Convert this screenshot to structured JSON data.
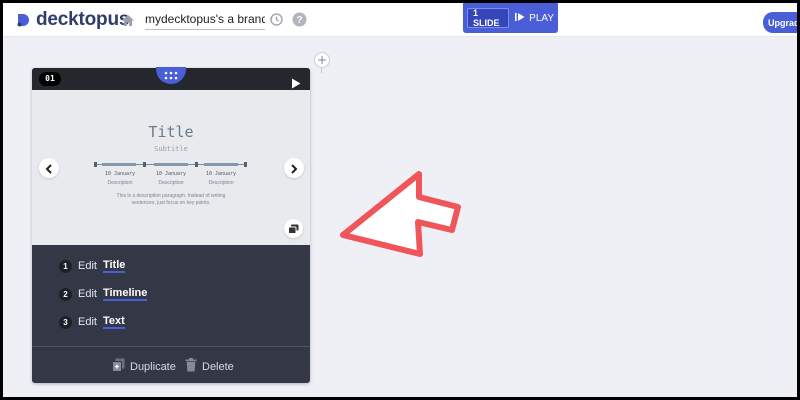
{
  "header": {
    "logo_text": "decktopus",
    "deck_name": "mydecktopus's a brand new",
    "slides_label": "1 SLIDE",
    "play_label": "PLAY",
    "upgrade_label": "Upgrade"
  },
  "add_slide": {
    "symbol": "+"
  },
  "slide": {
    "number": "01",
    "preview": {
      "title": "Title",
      "subtitle": "Subtitle",
      "timeline": [
        {
          "date": "10 January",
          "desc": "Description"
        },
        {
          "date": "10 January",
          "desc": "Description"
        },
        {
          "date": "10 January",
          "desc": "Description"
        }
      ],
      "paragraph": "This is a description paragraph. Instead of writing sentences, just focus on key points."
    },
    "progress_fraction": 0.5,
    "dots": [
      true,
      false
    ],
    "edits": [
      {
        "num": "1",
        "prefix": "Edit",
        "target": "Title"
      },
      {
        "num": "2",
        "prefix": "Edit",
        "target": "Timeline"
      },
      {
        "num": "3",
        "prefix": "Edit",
        "target": "Text"
      }
    ],
    "actions": {
      "duplicate_label": "Duplicate",
      "delete_label": "Delete"
    }
  },
  "colors": {
    "brand": "#4a5ed8",
    "card_bg": "#343746",
    "arrow": "#f0555a"
  }
}
